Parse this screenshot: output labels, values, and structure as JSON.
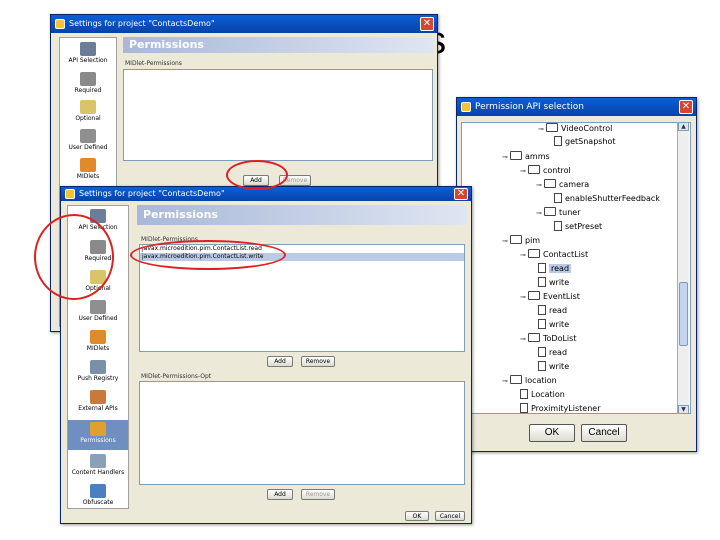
{
  "slide": {
    "title": "issions"
  },
  "back_window": {
    "title": "Settings for project \"ContactsDemo\"",
    "sidebar": [
      {
        "label": "API Selection",
        "icon": "api-selection-icon"
      },
      {
        "label": "Required",
        "icon": "required-icon"
      },
      {
        "label": "Optional",
        "icon": "optional-icon"
      },
      {
        "label": "User Defined",
        "icon": "user-defined-icon"
      },
      {
        "label": "MIDlets",
        "icon": "midlets-icon"
      }
    ],
    "panel_title": "Permissions",
    "list_label": "MIDlet-Permissions",
    "add_label": "Add",
    "remove_label": "Remove"
  },
  "front_window": {
    "title": "Settings for project \"ContactsDemo\"",
    "sidebar": [
      {
        "label": "API Selection",
        "icon": "api-selection-icon"
      },
      {
        "label": "Required",
        "icon": "required-icon"
      },
      {
        "label": "Optional",
        "icon": "optional-icon"
      },
      {
        "label": "User Defined",
        "icon": "user-defined-icon"
      },
      {
        "label": "MIDlets",
        "icon": "midlets-icon"
      },
      {
        "label": "Push Registry",
        "icon": "push-registry-icon"
      },
      {
        "label": "External APIs",
        "icon": "external-apis-icon"
      },
      {
        "label": "Permissions",
        "icon": "permissions-icon"
      },
      {
        "label": "Content Handlers",
        "icon": "content-handlers-icon"
      },
      {
        "label": "Obfuscate",
        "icon": "obfuscate-icon"
      }
    ],
    "selected_sidebar_index": 7,
    "panel_title": "Permissions",
    "permissions_label": "MIDlet-Permissions",
    "permissions": [
      "javax.microedition.pim.ContactList.read",
      "javax.microedition.pim.ContactList.write"
    ],
    "permissions_opt_label": "MIDlet-Permissions-Opt",
    "permissions_opt": [],
    "add_label": "Add",
    "remove_label": "Remove",
    "ok_label": "OK",
    "cancel_label": "Cancel"
  },
  "api_dialog": {
    "title": "Permission API selection",
    "tree": [
      {
        "label": "VideoControl",
        "kind": "folder",
        "depth": 3
      },
      {
        "label": "getSnapshot",
        "kind": "leaf",
        "depth": 4
      },
      {
        "label": "amms",
        "kind": "folder",
        "depth": 1
      },
      {
        "label": "control",
        "kind": "folder",
        "depth": 2
      },
      {
        "label": "camera",
        "kind": "folder",
        "depth": 3
      },
      {
        "label": "enableShutterFeedback",
        "kind": "leaf",
        "depth": 4
      },
      {
        "label": "tuner",
        "kind": "folder",
        "depth": 3
      },
      {
        "label": "setPreset",
        "kind": "leaf",
        "depth": 4
      },
      {
        "label": "pim",
        "kind": "folder",
        "depth": 1
      },
      {
        "label": "ContactList",
        "kind": "folder",
        "depth": 2
      },
      {
        "label": "read",
        "kind": "leaf",
        "depth": 3,
        "selected": true
      },
      {
        "label": "write",
        "kind": "leaf",
        "depth": 3
      },
      {
        "label": "EventList",
        "kind": "folder",
        "depth": 2
      },
      {
        "label": "read",
        "kind": "leaf",
        "depth": 3
      },
      {
        "label": "write",
        "kind": "leaf",
        "depth": 3
      },
      {
        "label": "ToDoList",
        "kind": "folder",
        "depth": 2
      },
      {
        "label": "read",
        "kind": "leaf",
        "depth": 3
      },
      {
        "label": "write",
        "kind": "leaf",
        "depth": 3
      },
      {
        "label": "location",
        "kind": "folder",
        "depth": 1
      },
      {
        "label": "Location",
        "kind": "leaf",
        "depth": 2
      },
      {
        "label": "ProximityListener",
        "kind": "leaf",
        "depth": 2
      }
    ],
    "ok_label": "OK",
    "cancel_label": "Cancel"
  },
  "colors": {
    "accent_red": "#e02020",
    "titlebar_blue": "#0842a8",
    "selection": "#b9c9e6"
  }
}
